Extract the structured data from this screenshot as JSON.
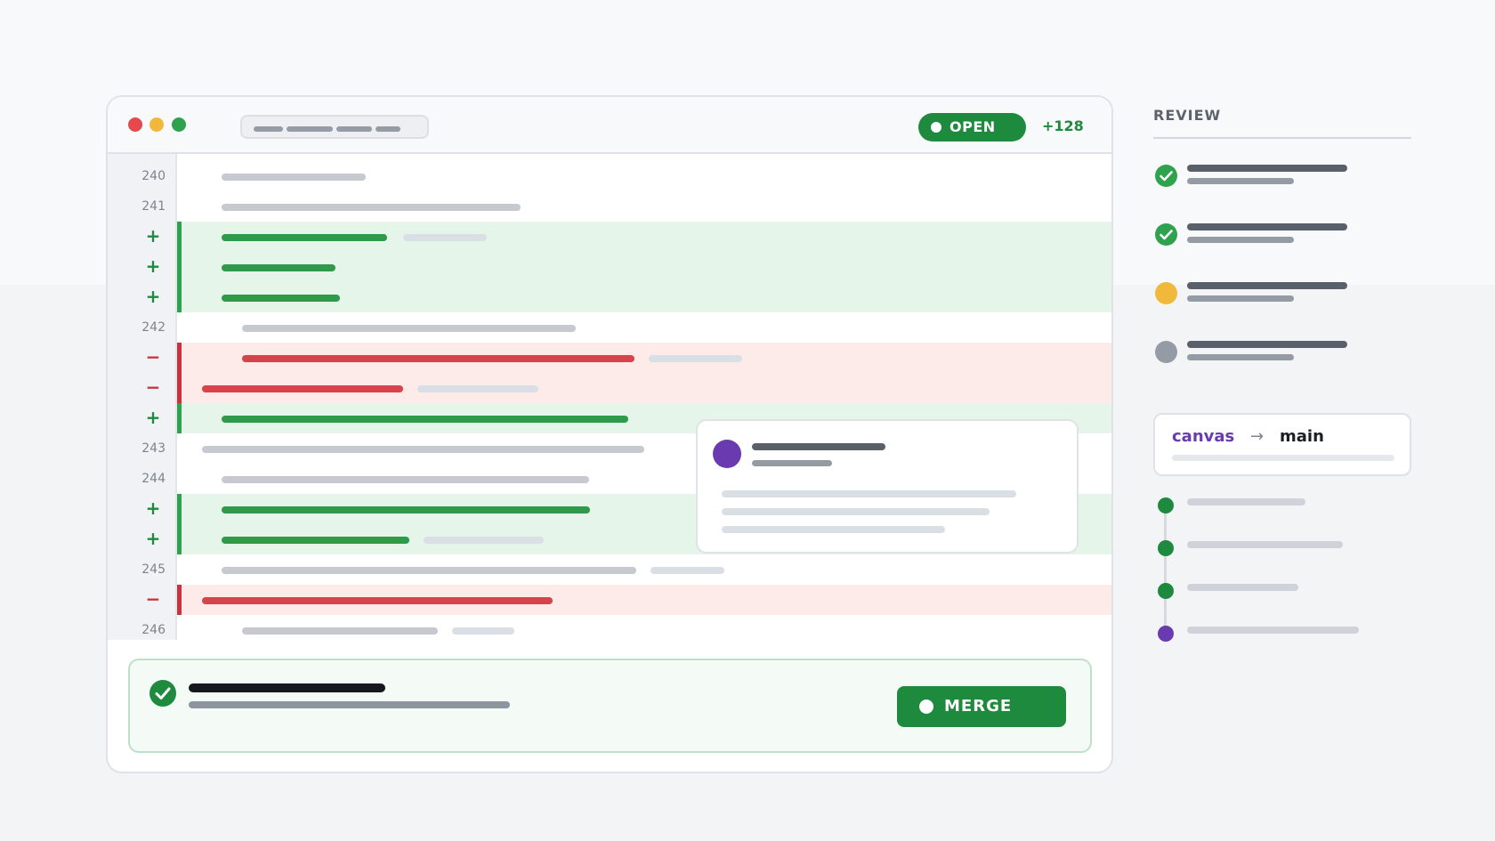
{
  "window": {
    "traffic_lights": [
      "#e5484d",
      "#f0b93b",
      "#2ea24d"
    ],
    "status_badge": "OPEN",
    "change_count": "+128"
  },
  "diff": {
    "rows": [
      {
        "kind": "context",
        "num": "240"
      },
      {
        "kind": "context",
        "num": "241"
      },
      {
        "kind": "add",
        "sym": "+"
      },
      {
        "kind": "add",
        "sym": "+"
      },
      {
        "kind": "add",
        "sym": "+"
      },
      {
        "kind": "context",
        "num": "242"
      },
      {
        "kind": "del",
        "sym": "−"
      },
      {
        "kind": "del",
        "sym": "−"
      },
      {
        "kind": "add",
        "sym": "+"
      },
      {
        "kind": "context",
        "num": "243"
      },
      {
        "kind": "context",
        "num": "244"
      },
      {
        "kind": "add",
        "sym": "+"
      },
      {
        "kind": "add",
        "sym": "+"
      },
      {
        "kind": "context",
        "num": "245"
      },
      {
        "kind": "del",
        "sym": "−"
      },
      {
        "kind": "context",
        "num": "246"
      }
    ]
  },
  "merge": {
    "button_label": "MERGE"
  },
  "sidebar": {
    "title": "REVIEW",
    "checks": [
      {
        "state": "passed",
        "icon": "check-icon",
        "color": "#2ea24d"
      },
      {
        "state": "passed",
        "icon": "check-icon",
        "color": "#2ea24d"
      },
      {
        "state": "pending",
        "icon": "pending-dot-icon",
        "color": "#f0b93b"
      },
      {
        "state": "queued",
        "icon": "queued-dot-icon",
        "color": "#959ba4"
      }
    ],
    "branch": {
      "from": "canvas",
      "arrow": "→",
      "to": "main"
    },
    "timeline_colors": [
      "#1e8a3e",
      "#1e8a3e",
      "#1e8a3e",
      "#6a3bb0"
    ]
  },
  "colors": {
    "accent_green": "#1e8a3e",
    "accent_purple": "#6a3bb0",
    "deletion_red": "#c93340"
  }
}
